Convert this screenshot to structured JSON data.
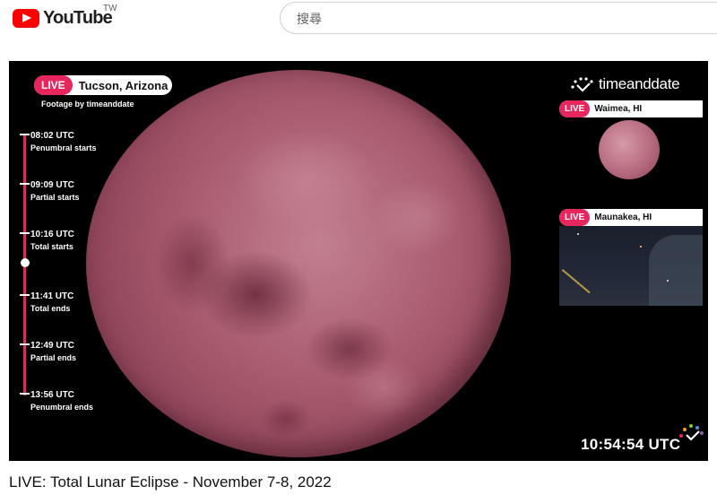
{
  "header": {
    "logo_text": "YouTube",
    "country": "TW",
    "search_placeholder": "搜尋"
  },
  "player": {
    "live_label": "LIVE",
    "location": "Tucson, Arizona",
    "footage": "Footage by timeanddate",
    "timeline": [
      {
        "time": "08:02 UTC",
        "label": "Penumbral starts"
      },
      {
        "time": "09:09 UTC",
        "label": "Partial starts"
      },
      {
        "time": "10:16 UTC",
        "label": "Total starts"
      },
      {
        "time": "11:41 UTC",
        "label": "Total ends"
      },
      {
        "time": "12:49 UTC",
        "label": "Partial ends"
      },
      {
        "time": "13:56 UTC",
        "label": "Penumbral ends"
      }
    ],
    "brand": "timeanddate",
    "cams": [
      {
        "live_label": "LIVE",
        "location": "Waimea, HI"
      },
      {
        "live_label": "LIVE",
        "location": "Maunakea, HI"
      }
    ],
    "clock": "10:54:54 UTC",
    "accent_color": "#e8265e"
  },
  "video": {
    "title": "LIVE: Total Lunar Eclipse - November 7-8, 2022"
  }
}
